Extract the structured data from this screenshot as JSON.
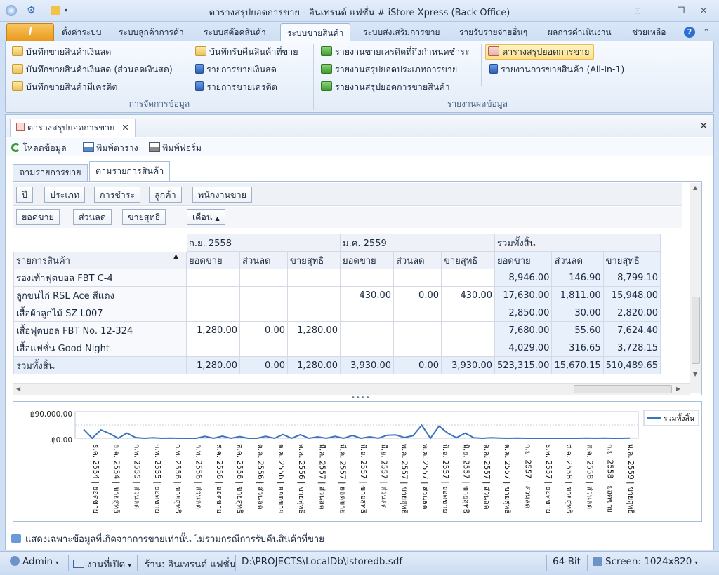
{
  "window": {
    "title": "ตารางสรุปยอดการขาย - อินเทรนด์ แฟชั่น # iStore Xpress (Back Office)",
    "controls": [
      "⊡",
      "—",
      "❐",
      "✕"
    ]
  },
  "ribbon": {
    "app_button": "i",
    "tabs": [
      "ตั้งค่าระบบ",
      "ระบบลูกค้าการค้า",
      "ระบบสต๊อคสินค้า",
      "ระบบขายสินค้า",
      "ระบบส่งเสริมการขาย",
      "รายรับรายจ่ายอื่นๆ",
      "ผลการดำเนินงาน",
      "ช่วยเหลือ"
    ],
    "active_tab": "ระบบขายสินค้า",
    "groups": {
      "data_mgmt": {
        "label": "การจัดการข้อมูล",
        "col1": [
          "บันทึกขายสินค้าเงินสด",
          "บันทึกขายสินค้าเงินสด (ส่วนลดเงินสด)",
          "บันทึกขายสินค้ามีเครดิต"
        ],
        "col2": [
          "บันทึกรับคืนสินค้าที่ขาย",
          "รายการขายเงินสด",
          "รายการขายเครดิต"
        ]
      },
      "reports": {
        "label": "รายงานผลข้อมูล",
        "col1": [
          "รายงานขายเครดิตที่ถึงกำหนดชำระ",
          "รายงานสรุปยอดประเภทการขาย",
          "รายงานสรุปยอดการขายสินค้า"
        ],
        "col2": [
          "ตารางสรุปยอดการขาย",
          "รายงานการขายสินค้า (All-In-1)"
        ]
      }
    }
  },
  "document": {
    "tab_label": "ตารางสรุปยอดการขาย",
    "toolbar": {
      "reload": "โหลดข้อมูล",
      "print_table": "พิมพ์ตาราง",
      "print_form": "พิมพ์ฟอร์ม"
    },
    "view_tabs": [
      "ตามรายการขาย",
      "ตามรายการสินค้า"
    ],
    "active_view": "ตามรายการสินค้า"
  },
  "pivot": {
    "filter_fields": [
      "ปี",
      "ประเภท",
      "การชำระ",
      "ลูกค้า",
      "พนักงานขาย"
    ],
    "data_fields": [
      "ยอดขาย",
      "ส่วนลด",
      "ขายสุทธิ"
    ],
    "column_field": "เดือน",
    "row_field": "รายการสินค้า",
    "column_groups": [
      "ก.ย. 2558",
      "ม.ค. 2559",
      "รวมทั้งสิ้น"
    ],
    "measure_headers": [
      "ยอดขาย",
      "ส่วนลด",
      "ขายสุทธิ"
    ],
    "rows": [
      {
        "name": "รองเท้าฟุตบอล FBT C-4",
        "cells": [
          "",
          "",
          "",
          "",
          "",
          "",
          "8,946.00",
          "146.90",
          "8,799.10"
        ]
      },
      {
        "name": "ลูกขนไก่ RSL Ace สีแดง",
        "cells": [
          "",
          "",
          "",
          "430.00",
          "0.00",
          "430.00",
          "17,630.00",
          "1,811.00",
          "15,948.00"
        ]
      },
      {
        "name": "เสื้อผ้าลูกไม้ SZ L007",
        "cells": [
          "",
          "",
          "",
          "",
          "",
          "",
          "2,850.00",
          "30.00",
          "2,820.00"
        ]
      },
      {
        "name": "เสื้อฟุตบอล FBT No. 12-324",
        "cells": [
          "1,280.00",
          "0.00",
          "1,280.00",
          "",
          "",
          "",
          "7,680.00",
          "55.60",
          "7,624.40"
        ]
      },
      {
        "name": "เสื้อแฟชั่น Good Night",
        "cells": [
          "",
          "",
          "",
          "",
          "",
          "",
          "4,029.00",
          "316.65",
          "3,728.15"
        ]
      }
    ],
    "total": {
      "name": "รวมทั้งสิ้น",
      "cells": [
        "1,280.00",
        "0.00",
        "1,280.00",
        "3,930.00",
        "0.00",
        "3,930.00",
        "523,315.00",
        "15,670.15",
        "510,489.65"
      ]
    }
  },
  "chart_data": {
    "type": "line",
    "title": "",
    "ylabel": "",
    "xlabel": "",
    "ylim": [
      0,
      90000
    ],
    "y_ticks": [
      "฿90,000.00",
      "฿0.00"
    ],
    "series": [
      {
        "name": "รวมทั้งสิ้น",
        "color": "#3d73b9",
        "values": [
          38000,
          0,
          36000,
          20000,
          0,
          22000,
          3000,
          0,
          2000,
          0,
          1000,
          0,
          0,
          0,
          8000,
          0,
          9000,
          0,
          7000,
          0,
          0,
          8000,
          0,
          16000,
          0,
          15000,
          0,
          6000,
          0,
          8000,
          0,
          12000,
          0,
          6000,
          0,
          13000,
          14000,
          3000,
          11000,
          56000,
          0,
          52000,
          22000,
          2000,
          22000,
          2000,
          0,
          2000,
          1000,
          0,
          1000,
          0,
          0,
          0,
          0,
          0,
          0,
          0,
          1000,
          0,
          1000,
          0,
          0,
          1000
        ]
      }
    ],
    "x_tick_labels": [
      "ธ.ค. 2554 | ยอดขาย",
      "ธ.ค. 2554 | ขายสุทธิ",
      "ก.พ. 2555 | ส่วนลด",
      "ก.พ. 2555 | ยอดขาย",
      "ก.พ. 2556 | ขายสุทธิ",
      "ก.พ. 2556 | ส่วนลด",
      "ส.ค. 2556 | ยอดขาย",
      "ส.ค. 2556 | ขายสุทธิ",
      "ต.ค. 2556 | ส่วนลด",
      "ต.ค. 2556 | ยอดขาย",
      "ต.ค. 2556 | ขายสุทธิ",
      "มี.ค. 2557 | ส่วนลด",
      "มี.ค. 2557 | ยอดขาย",
      "มี.ย. 2557 | ขายสุทธิ",
      "มี.ย. 2557 | ส่วนลด",
      "พ.ค. 2557 | ขายสุทธิ",
      "พ.ค. 2557 | ส่วนลด",
      "มิ.ย. 2557 | ยอดขาย",
      "มิ.ย. 2557 | ขายสุทธิ",
      "ต.ค. 2557 | ส่วนลด",
      "ต.ค. 2557 | ขายสุทธิ",
      "ก.ย. 2557 | ส่วนลด",
      "ธ.ค. 2557 | ยอดขาย",
      "ส.ค. 2558 | ขายสุทธิ",
      "ส.ค. 2558 | ส่วนลด",
      "ก.ย. 2558 | ยอดขาย",
      "ม.ค. 2559 | ขายสุทธิ"
    ],
    "legend": "top-right",
    "legend_label": "รวมทั้งสิ้น",
    "grid": true
  },
  "footer_note": "แสดงเฉพาะข้อมูลที่เกิดจากการขายเท่านั้น ไม่รวมกรณีการรับคืนสินค้าที่ขาย",
  "statusbar": {
    "user": "Admin",
    "open_jobs": "งานที่เปิด",
    "shop": "ร้าน: อินเทรนด์ แฟชั่น",
    "db_path": "D:\\PROJECTS\\LocalDb\\istoredb.sdf",
    "arch": "64-Bit",
    "screen": "Screen: 1024x820"
  }
}
